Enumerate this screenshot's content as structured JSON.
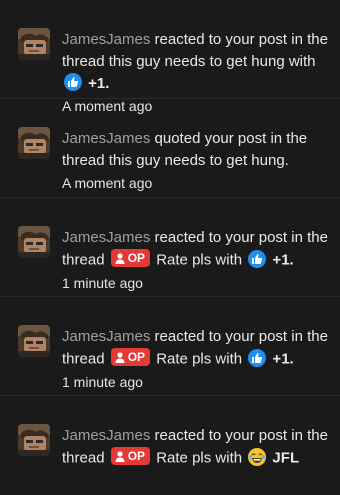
{
  "notifications": [
    {
      "user": "JamesJames",
      "segments": [
        {
          "t": "text",
          "v": " reacted to your post in the thread this guy needs to get hung with "
        },
        {
          "t": "like-icon"
        },
        {
          "t": "bold",
          "v": " +1."
        }
      ],
      "time": "A moment ago"
    },
    {
      "user": "JamesJames",
      "segments": [
        {
          "t": "text",
          "v": " quoted your post in the thread this guy needs to get hung."
        }
      ],
      "time": "A moment ago"
    },
    {
      "user": "JamesJames",
      "segments": [
        {
          "t": "text",
          "v": " reacted to your post in the thread "
        },
        {
          "t": "op-badge",
          "v": "OP"
        },
        {
          "t": "text",
          "v": " Rate pls with "
        },
        {
          "t": "like-icon"
        },
        {
          "t": "bold",
          "v": " +1."
        }
      ],
      "time": "1 minute ago"
    },
    {
      "user": "JamesJames",
      "segments": [
        {
          "t": "text",
          "v": " reacted to your post in the thread "
        },
        {
          "t": "op-badge",
          "v": "OP"
        },
        {
          "t": "text",
          "v": " Rate pls with "
        },
        {
          "t": "like-icon"
        },
        {
          "t": "bold",
          "v": " +1."
        }
      ],
      "time": "1 minute ago"
    },
    {
      "user": "JamesJames",
      "segments": [
        {
          "t": "text",
          "v": " reacted to your post in the thread "
        },
        {
          "t": "op-badge",
          "v": "OP"
        },
        {
          "t": "text",
          "v": " Rate pls with "
        },
        {
          "t": "laugh-icon"
        },
        {
          "t": "bold",
          "v": " JFL"
        }
      ],
      "time": ""
    }
  ],
  "colors": {
    "background": "#1a1a1a",
    "username": "#9aa0a6",
    "like": "#1f8ef1",
    "op_badge": "#e53935"
  }
}
